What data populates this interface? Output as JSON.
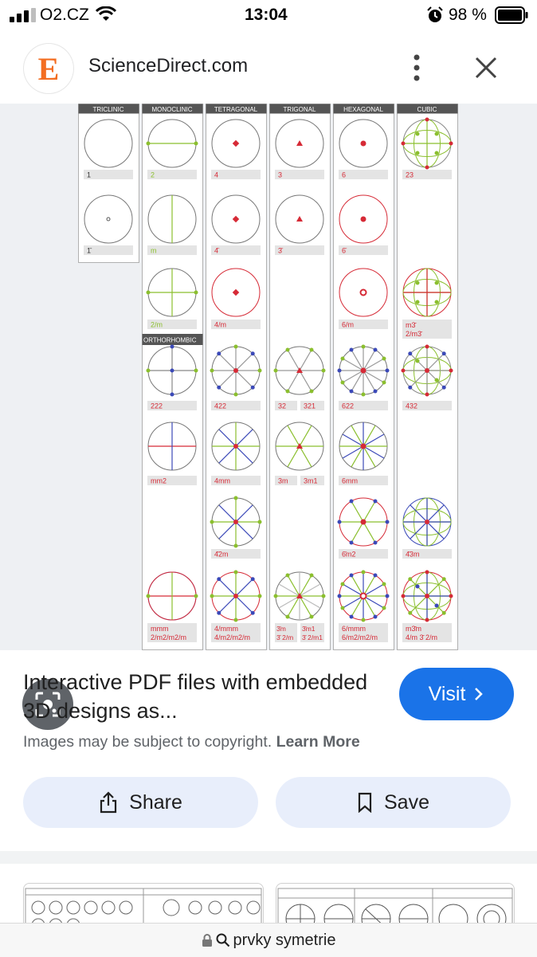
{
  "status_bar": {
    "carrier": "O2.CZ",
    "time": "13:04",
    "battery_percent": "98 %"
  },
  "header": {
    "logo_letter": "E",
    "site_name": "ScienceDirect.com",
    "menu_icon": "more-vert-icon",
    "close_icon": "close-icon"
  },
  "figure": {
    "systems": [
      "TRICLINIC",
      "MONOCLINIC",
      "TETRAGONAL",
      "TRIGONAL",
      "HEXAGONAL",
      "CUBIC"
    ],
    "orthorhombic_label": "ORTHORHOMBIC",
    "labels": {
      "triclinic": [
        "1",
        "1̄"
      ],
      "monoclinic": [
        "2",
        "m",
        "2/m"
      ],
      "orthorhombic": [
        "222",
        "mm2",
        "mmm",
        "2/m2/m2/m"
      ],
      "tetragonal": [
        "4",
        "4̄",
        "4/m",
        "422",
        "4mm",
        "4̄2m",
        "4/mmm",
        "4/m2/m2/m"
      ],
      "trigonal": [
        "3",
        "3̄",
        "32",
        "321",
        "3m",
        "3m1",
        "3̄m",
        "3̄m1",
        "3̄ 2/m",
        "3̄ 2/m1"
      ],
      "hexagonal": [
        "6",
        "6̄",
        "6/m",
        "622",
        "6mm",
        "6̄m2",
        "6/mmm",
        "6/m2/m2/m"
      ],
      "cubic": [
        "23",
        "m3̄",
        "2/m3̄",
        "432",
        "4̄3m",
        "m3̄m",
        "4/m 3̄ 2/m"
      ]
    }
  },
  "visual_search_icon": "lens-icon",
  "result": {
    "title": "Interactive PDF files with embedded 3D designs as...",
    "visit_label": "Visit",
    "copyright_text": "Images may be subject to copyright.",
    "learn_more": "Learn More"
  },
  "actions": {
    "share_label": "Share",
    "save_label": "Save"
  },
  "url_bar": {
    "query": "prvky symetrie"
  },
  "colors": {
    "accent": "#1a73e8",
    "pill": "#e8eefb",
    "red": "#d62a36",
    "green": "#8bbf2e",
    "blue": "#3b49b8"
  }
}
